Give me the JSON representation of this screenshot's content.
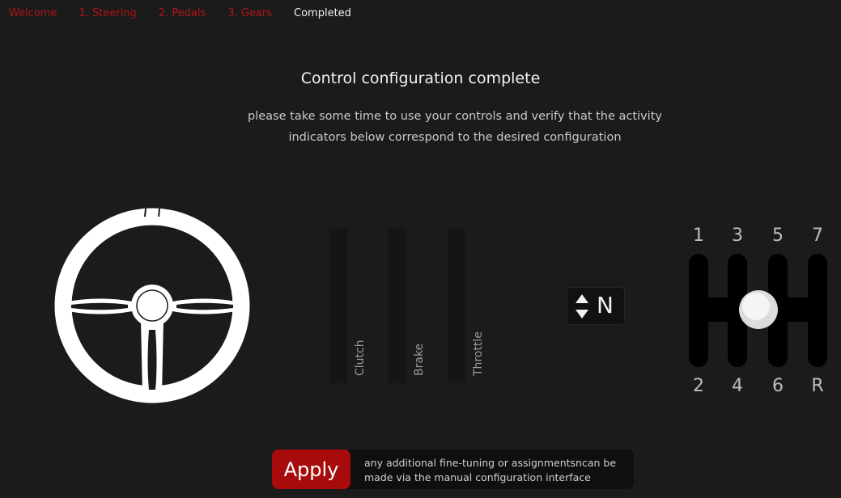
{
  "tabs": [
    {
      "label": "Welcome",
      "active": false
    },
    {
      "label": "1. Steering",
      "active": false
    },
    {
      "label": "2. Pedals",
      "active": false
    },
    {
      "label": "3. Gears",
      "active": false
    },
    {
      "label": "Completed",
      "active": true
    }
  ],
  "header": {
    "title": "Control configuration complete",
    "subtitle": "please take some time to use your controls and verify that the activity indicators below correspond to the desired configuration"
  },
  "pedals": [
    {
      "label": "Clutch",
      "level": 0
    },
    {
      "label": "Brake",
      "level": 0
    },
    {
      "label": "Throttle",
      "level": 0
    }
  ],
  "gear_indicator": {
    "value": "N"
  },
  "shifter": {
    "top_gears": [
      "1",
      "3",
      "5",
      "7"
    ],
    "bottom_gears": [
      "2",
      "4",
      "6",
      "R"
    ]
  },
  "apply": {
    "button_label": "Apply",
    "note": "any additional fine-tuning or assignmentsncan be made via the manual configuration interface"
  },
  "colors": {
    "accent": "#b01418",
    "background": "#1b1b1b"
  }
}
